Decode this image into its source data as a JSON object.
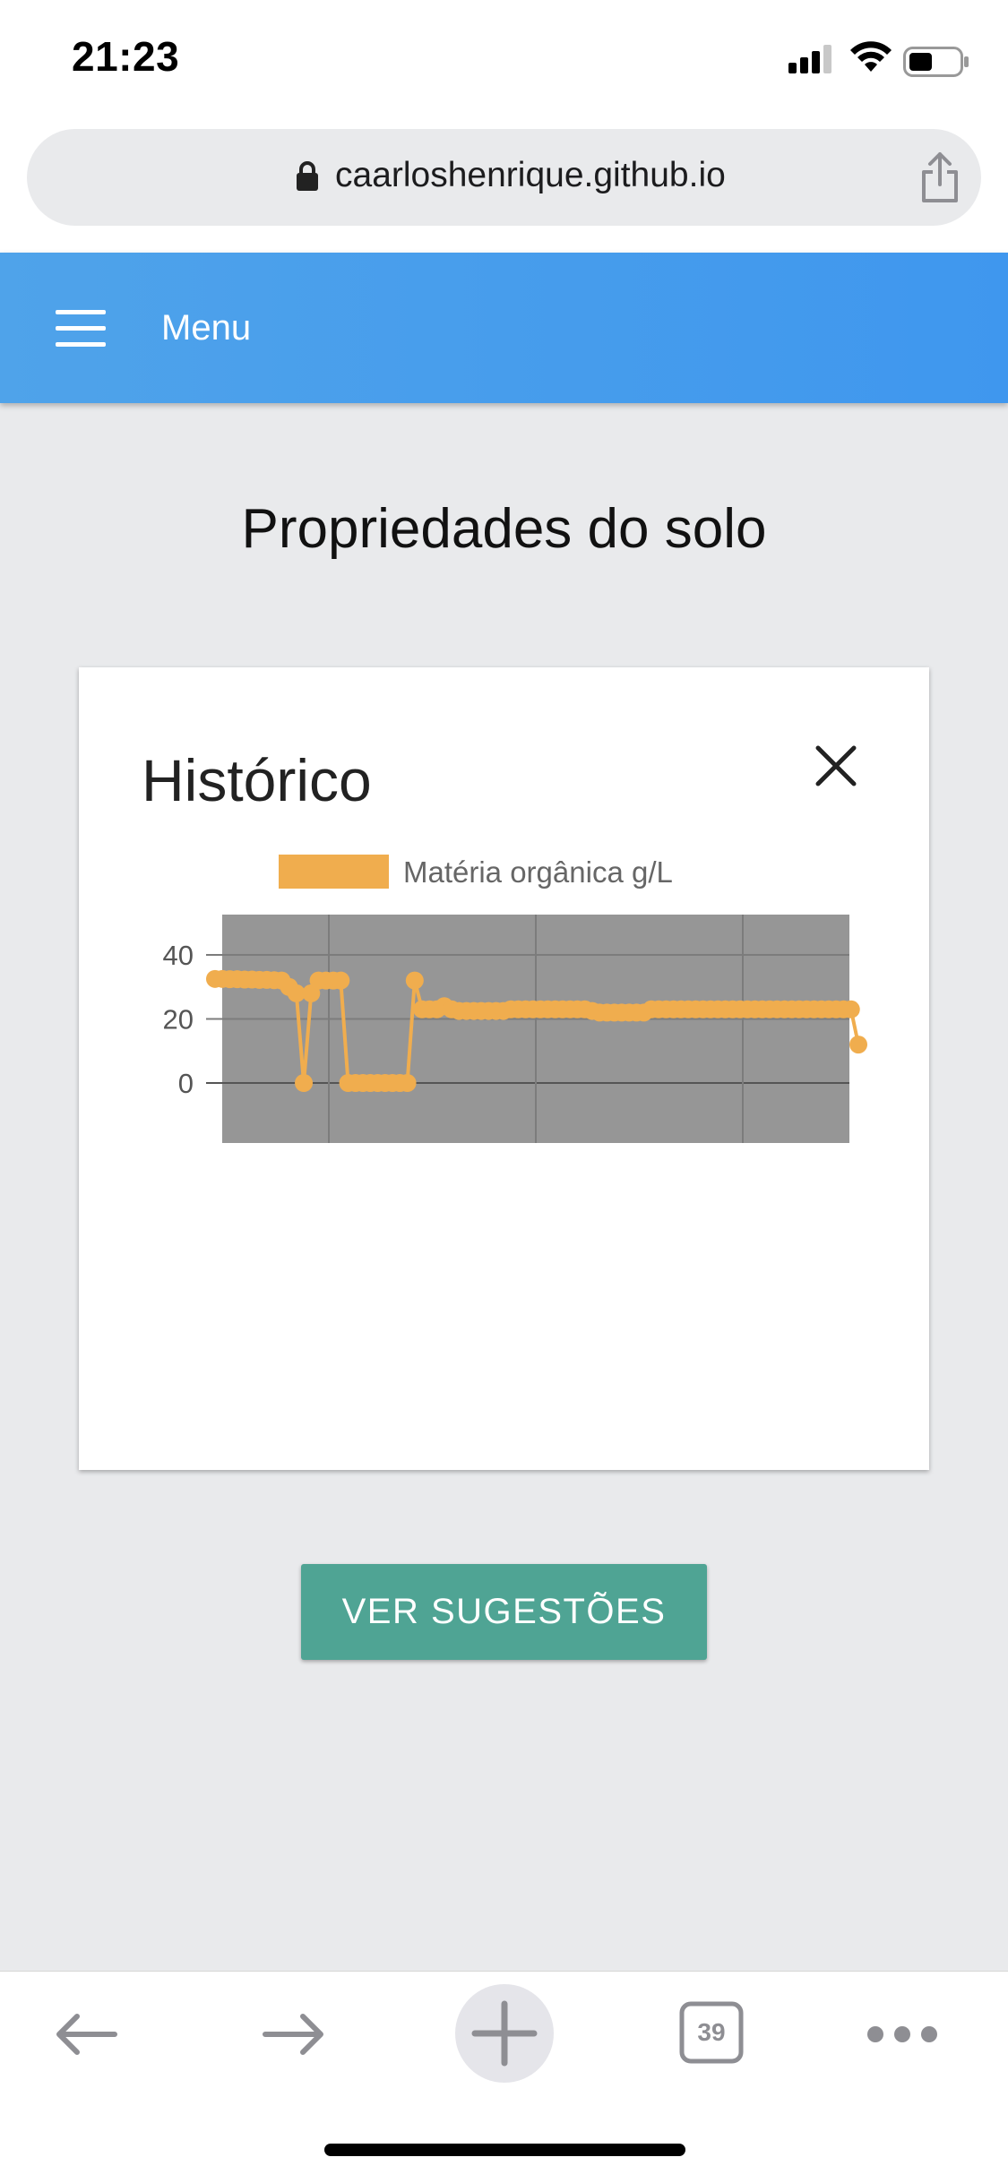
{
  "status": {
    "time": "21:23"
  },
  "browser": {
    "url": "caarloshenrique.github.io",
    "tabs_count": "39"
  },
  "header": {
    "menu_label": "Menu"
  },
  "page": {
    "title": "Propriedades do solo"
  },
  "card": {
    "title": "Histórico"
  },
  "button": {
    "label": "VER SUGESTÕES"
  },
  "colors": {
    "accent": "#4fa494",
    "header": "#4a9dec",
    "series": "#f0ad4e",
    "plot_bg": "#969696"
  },
  "chart_data": {
    "type": "line",
    "title": "",
    "xlabel": "",
    "ylabel": "",
    "ylim": [
      0,
      40
    ],
    "yticks": [
      "40",
      "20",
      "0"
    ],
    "grid": true,
    "legend": "top",
    "series": [
      {
        "name": "Matéria orgânica g/L",
        "values": [
          32.5,
          32.5,
          32.4,
          32.4,
          32.3,
          32.3,
          32.2,
          32.2,
          32.1,
          32.0,
          30.0,
          28.0,
          0,
          28.0,
          32.0,
          32.0,
          32.0,
          32.0,
          0,
          0,
          0,
          0,
          0,
          0,
          0,
          0,
          0,
          32,
          23,
          23,
          23,
          24,
          23,
          22.5,
          22.5,
          22.5,
          22.5,
          22.5,
          22.5,
          22.5,
          23,
          23,
          23,
          23,
          23,
          23,
          23,
          23,
          23,
          23,
          23,
          22.5,
          22,
          22,
          22,
          22,
          22,
          22,
          22,
          23,
          23,
          23,
          23,
          23,
          23,
          23,
          23,
          23,
          23,
          23,
          23,
          23,
          23,
          23,
          23,
          23,
          23,
          23,
          23,
          23,
          23,
          23,
          23,
          23,
          23,
          23,
          23,
          12
        ]
      }
    ]
  }
}
